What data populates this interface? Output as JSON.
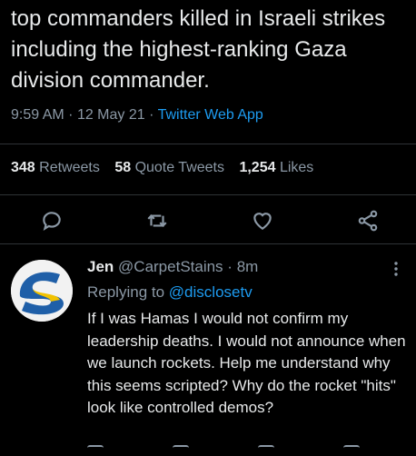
{
  "tweet": {
    "text": "top commanders killed in Israeli strikes including the highest-ranking Gaza division commander.",
    "time": "9:59 AM",
    "date": "12 May 21",
    "source": "Twitter Web App"
  },
  "stats": {
    "retweets_count": "348",
    "retweets_label": "Retweets",
    "quote_count": "58",
    "quote_label": "Quote Tweets",
    "likes_count": "1,254",
    "likes_label": "Likes"
  },
  "actions": [
    "reply-icon",
    "retweet-icon",
    "like-icon",
    "share-icon"
  ],
  "reply": {
    "name": "Jen",
    "handle": "@CarpetStains",
    "age": "8m",
    "replying_prefix": "Replying to",
    "replying_handle": "@disclosetv",
    "text": "If I was Hamas I would not confirm my leadership deaths. I would not announce when we launch rockets. Help me understand why this seems scripted? Why do the rocket \"hits\" look like controlled demos?"
  },
  "colors": {
    "background": "#000000",
    "text": "#e7e9ea",
    "muted": "#8b98a5",
    "link": "#1d9bf0",
    "avatar_blue": "#1f5fa8",
    "avatar_yellow": "#f2c200"
  }
}
